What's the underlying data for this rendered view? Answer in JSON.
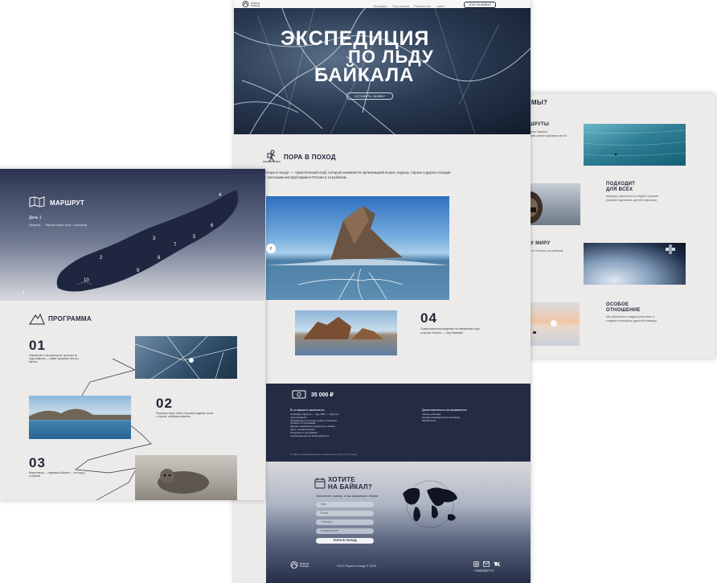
{
  "center": {
    "nav": {
      "logo_text": "ПОРА В ПОХОД",
      "items": [
        "Маршрут",
        "Программа",
        "Почему мы",
        "Цена"
      ],
      "cta_label": "ХОЧУ НА БАЙКАЛ"
    },
    "hero": {
      "title_line1": "Экспедиция",
      "title_line2": "по льду",
      "title_line3": "Байкала",
      "button_label": "ОСТАВИТЬ ЗАЯВКУ"
    },
    "about": {
      "title": "ПОРА В ПОХОД",
      "text": "«Пора в поход» — туристический клуб, который занимается организацией пеших, водных, горных и других походов с опытными инструкторами в России и за рубежом.",
      "slider_prev": "‹"
    },
    "step4": {
      "number": "04",
      "text": "Совершаем восхождение на священную гору острова Ольхон — гору Ижимей."
    },
    "price": {
      "amount": "35 000 ₽",
      "included_title": "В стоимость включено:",
      "included_items": [
        "трансфер: Иркутск — лед, МРС — Иркутск;",
        "гид-проводник;",
        "проживание в гостевых домах и палатках;",
        "питание по программе;",
        "аренда снаряжения (ледоступы, кошки);",
        "фото- и видеосъемка;",
        "экскурсии по программе;",
        "сопровождение на всём маршруте."
      ],
      "extra_title": "Дополнительно оплачивается:",
      "extra_items": [
        "личные расходы;",
        "аренда снаряжения (по желанию);",
        "авиабилеты."
      ],
      "note": "Стоимость указана на одного человека при группе от 6 человек."
    },
    "form": {
      "title_line1": "ХОТИТЕ",
      "title_line2": "НА БАЙКАЛ?",
      "subtitle": "Заполните заявку, и мы свяжемся с Вами",
      "name_placeholder": "Имя",
      "email_placeholder": "Email",
      "phone_placeholder": "Телефон",
      "comment_placeholder": "Комментарий",
      "submit_label": "ПОРА В ПОХОД"
    },
    "footer": {
      "logo_text": "ПОРА В ПОХОД",
      "copyright": "ООО Пора в поход © 2023",
      "phone": "+79453337777"
    }
  },
  "left": {
    "route": {
      "title": "МАРШРУТ",
      "day": "День 1",
      "description": "Иркутск → Малое море (пос. Сахюрта)",
      "markers": [
        "1",
        "2",
        "3",
        "4",
        "5",
        "6",
        "7",
        "8",
        "9",
        "10"
      ]
    },
    "program": {
      "title": "ПРОГРАММА",
      "steps": [
        {
          "number": "01",
          "text": "Знакомство с инструктором, прогулка по льду Байкала — самые красивые места у берега."
        },
        {
          "number": "02",
          "text": "Переход к мысу Хобой. Изучаем ледяные гроты и торосы, любуемся закатом."
        },
        {
          "number": "03",
          "text": "Ищем нерпу — эндемика Байкала — на льду у островов."
        }
      ]
    }
  },
  "right": {
    "why": {
      "title": "ПОЧЕМУ МЫ?",
      "cards": [
        {
          "title": "НАШИ МАРШРУТЫ",
          "text": "Все маршруты проверены нашими инструкторами. Мы знаем самые красивые места и безопасные тропы."
        },
        {
          "title": "ПОДХОДИТ ДЛЯ ВСЕХ",
          "text": "Маршрут рассчитан на людей с разным уровнем подготовки, детей и взрослых."
        },
        {
          "title": "ПО ВСЕМУ МИРУ",
          "text": "Организуем походы по России и за рубежом."
        },
        {
          "title": "ОСОБОЕ ОТНОШЕНИЕ",
          "text": "Мы заботимся о каждом участнике и создаём атмосферу дружной команды."
        }
      ]
    }
  },
  "colors": {
    "navy": "#242c44",
    "light_bg": "#ecebea",
    "accent_white": "#ffffff"
  }
}
